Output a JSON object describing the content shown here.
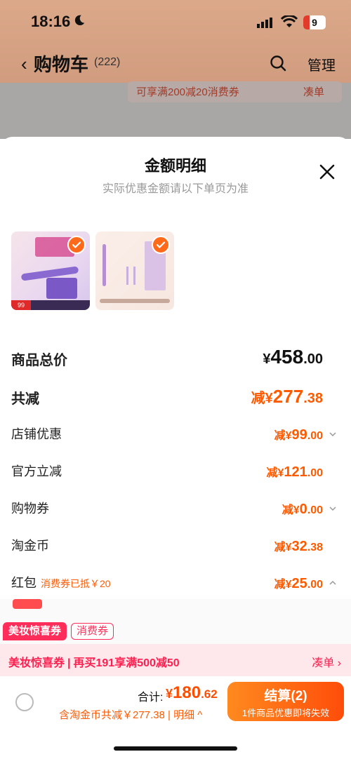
{
  "status_bar": {
    "time": "18:16",
    "battery": "9"
  },
  "nav": {
    "title": "购物车",
    "count": "(222)",
    "manage": "管理"
  },
  "background": {
    "coupon_text": "可享满200减20消费券",
    "coupon_action": "凑单"
  },
  "sheet": {
    "title": "金额明细",
    "subtitle": "实际优惠金额请以下单页为准",
    "thumb1_price": "99"
  },
  "summary": {
    "total_label": "商品总价",
    "total_yen": "¥",
    "total_int": "458",
    "total_dec": ".00",
    "discount_label": "共减",
    "discount_pre": "减¥",
    "discount_int": "277",
    "discount_dec": ".38"
  },
  "items": [
    {
      "label": "店铺优惠",
      "pre": "减¥",
      "int": "99",
      "dec": ".00",
      "note": ""
    },
    {
      "label": "官方立减",
      "pre": "减¥",
      "int": "121",
      "dec": ".00",
      "note": ""
    },
    {
      "label": "购物券",
      "pre": "减¥",
      "int": "0",
      "dec": ".00",
      "note": ""
    },
    {
      "label": "淘金币",
      "pre": "减¥",
      "int": "32",
      "dec": ".38",
      "note": ""
    },
    {
      "label": "红包",
      "pre": "减¥",
      "int": "25",
      "dec": ".00",
      "note": "消费券已抵￥20"
    }
  ],
  "promo": {
    "tag1": "美妆惊喜券",
    "tag2": "消费券",
    "text1": "美妆惊喜券",
    "text2": "再买191享满500减50",
    "action": "凑单 ›"
  },
  "footer": {
    "sum_label": "合计:",
    "sum_yen": "¥",
    "sum_int": "180",
    "sum_dec": ".62",
    "detail": "含淘金币共减￥277.38 | 明细 ^",
    "checkout": "结算(2)",
    "checkout_sub": "1件商品优惠即将失效"
  },
  "colors": {
    "accent": "#ff5a00",
    "promo": "#ff1f4f",
    "bg_header": "#dca88a"
  }
}
